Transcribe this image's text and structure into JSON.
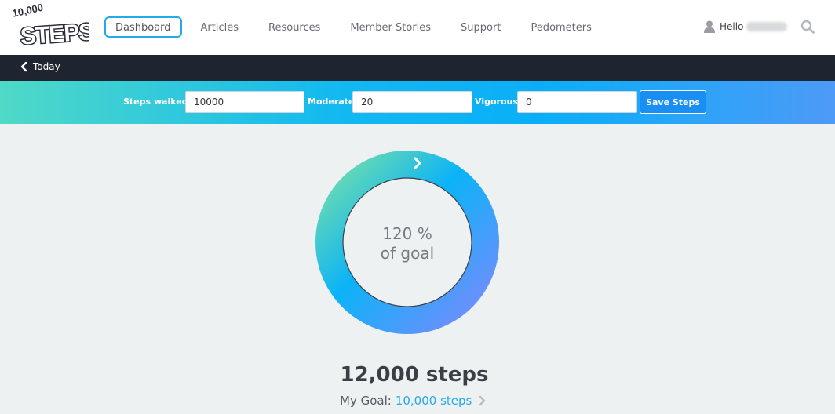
{
  "header": {
    "logo_text": "10,000 STEPS",
    "nav": [
      {
        "label": "Dashboard",
        "active": true
      },
      {
        "label": "Articles"
      },
      {
        "label": "Resources"
      },
      {
        "label": "Member Stories"
      },
      {
        "label": "Support"
      },
      {
        "label": "Pedometers"
      }
    ],
    "greeting": "Hello",
    "icons": {
      "user": "user-icon",
      "search": "search-icon"
    }
  },
  "subnav": {
    "back_label": "Today",
    "icon": "chevron-left-icon"
  },
  "entry": {
    "steps_label": "Steps walked",
    "steps_value": "10000",
    "moderate_label": "Moderate",
    "moderate_value": "20",
    "vigorous_label": "Vigorous",
    "vigorous_value": "0",
    "save_label": "Save Steps"
  },
  "progress": {
    "percent_text": "120 %",
    "caption": "of goal",
    "ring_fill_fraction": 1.0
  },
  "summary": {
    "total_steps": "12,000 steps",
    "goal_label": "My Goal:",
    "goal_value": "10,000 steps"
  },
  "colors": {
    "accent": "#24aae8",
    "dark_bar": "#1f2530",
    "gradient_start": "#4fd9c7",
    "gradient_mid": "#0aaef8",
    "gradient_end": "#4d9af7",
    "ring_start": "#7fe3a6",
    "ring_mid": "#0bb1f8",
    "ring_end": "#7b8bff"
  }
}
